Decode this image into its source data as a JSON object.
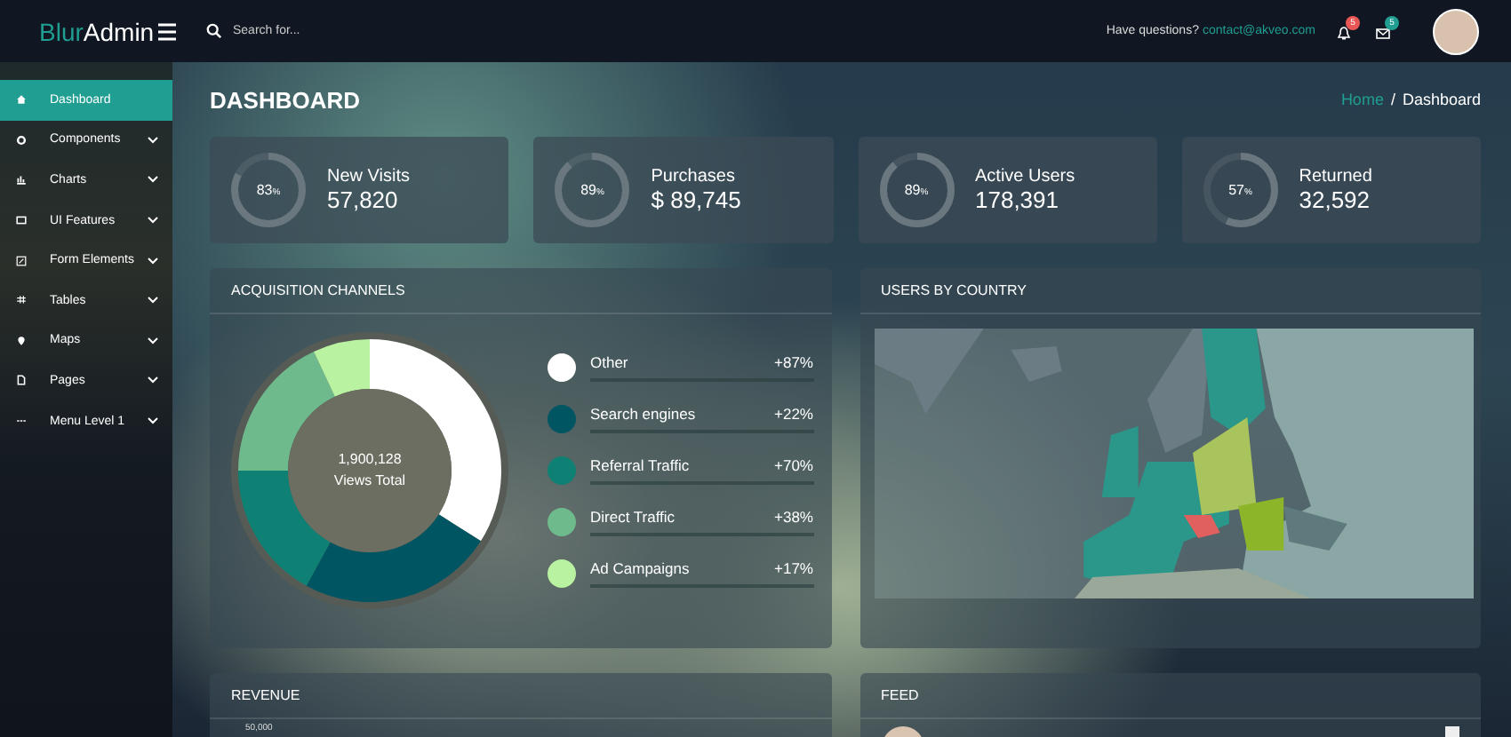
{
  "header": {
    "logo_first": "Blur",
    "logo_second": "Admin",
    "search": {
      "placeholder": "Search for..."
    },
    "question": "Have questions?",
    "contact": "contact@akveo.com",
    "notifications_badge": "5",
    "messages_badge": "5"
  },
  "sidebar": {
    "items": [
      {
        "label": "Dashboard",
        "selected": true,
        "expandable": false
      },
      {
        "label": "Components",
        "selected": false,
        "expandable": true
      },
      {
        "label": "Charts",
        "selected": false,
        "expandable": true
      },
      {
        "label": "UI Features",
        "selected": false,
        "expandable": true
      },
      {
        "label": "Form Elements",
        "selected": false,
        "expandable": true
      },
      {
        "label": "Tables",
        "selected": false,
        "expandable": true
      },
      {
        "label": "Maps",
        "selected": false,
        "expandable": true
      },
      {
        "label": "Pages",
        "selected": false,
        "expandable": true
      },
      {
        "label": "Menu Level 1",
        "selected": false,
        "expandable": true
      }
    ]
  },
  "page": {
    "title": "DASHBOARD",
    "breadcrumb": [
      {
        "label": "Home",
        "link": true
      },
      {
        "label": "Dashboard",
        "link": false
      }
    ],
    "separator": "/"
  },
  "stats": [
    {
      "percent": "83",
      "unit": "%",
      "level": 0.83,
      "label": "New Visits",
      "value": "57,820"
    },
    {
      "percent": "89",
      "unit": "%",
      "level": 0.89,
      "label": "Purchases",
      "value": "$ 89,745"
    },
    {
      "percent": "89",
      "unit": "%",
      "level": 0.89,
      "label": "Active Users",
      "value": "178,391"
    },
    {
      "percent": "57",
      "unit": "%",
      "level": 0.57,
      "label": "Returned",
      "value": "32,592"
    }
  ],
  "acquisition": {
    "title": "ACQUISITION CHANNELS",
    "total": "1,900,128",
    "total_label": "Views Total",
    "channels": [
      {
        "name": "Other",
        "change": "+87%",
        "color": "#ffffff"
      },
      {
        "name": "Search engines",
        "change": "+22%",
        "color": "#005562"
      },
      {
        "name": "Referral Traffic",
        "change": "+70%",
        "color": "#0e8174"
      },
      {
        "name": "Direct Traffic",
        "change": "+38%",
        "color": "#6eba8c"
      },
      {
        "name": "Ad Campaigns",
        "change": "+17%",
        "color": "#b9f2a1"
      }
    ]
  },
  "users_by_country": {
    "title": "USERS BY COUNTRY"
  },
  "revenue": {
    "title": "REVENUE",
    "y_tick": "50,000"
  },
  "feed": {
    "title": "FEED"
  }
}
